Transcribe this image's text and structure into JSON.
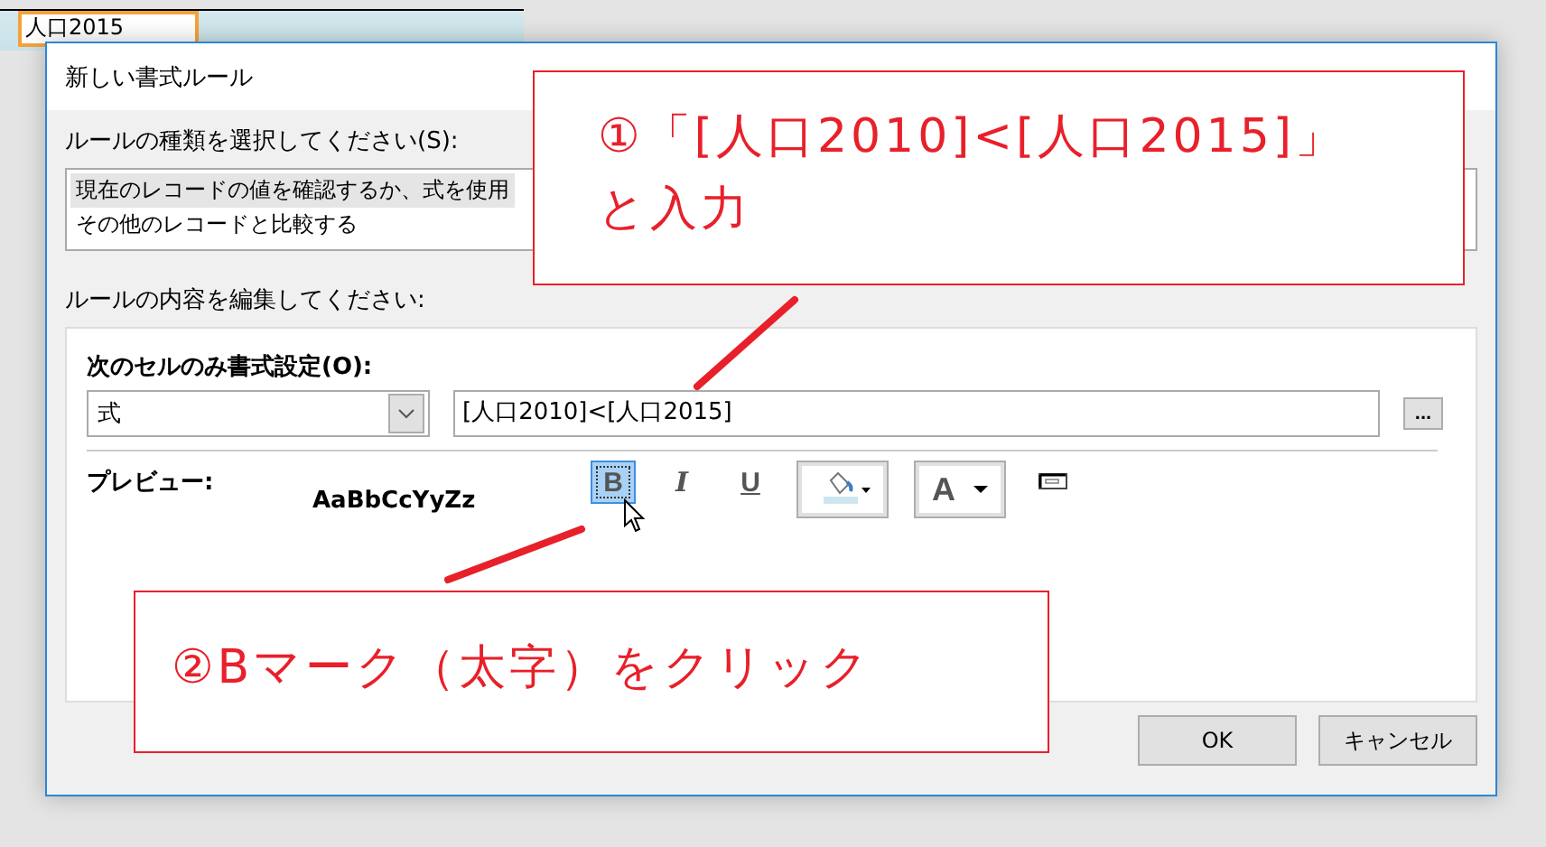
{
  "sheet": {
    "cell": "人口2015"
  },
  "dialog": {
    "title": "新しい書式ルール",
    "rule_type_label": "ルールの種類を選択してください(S):",
    "rule_types": [
      {
        "label": "現在のレコードの値を確認するか、式を使用",
        "selected": true
      },
      {
        "label": "その他のレコードと比較する",
        "selected": false
      }
    ],
    "edit_label": "ルールの内容を編集してください:",
    "condition_label": "次のセルのみ書式設定(O):",
    "condition_type": "式",
    "expression": "[人口2010]<[人口2015]",
    "browse": "...",
    "preview_label": "プレビュー:",
    "preview_sample": "AaBbCcYyZz",
    "format_buttons": [
      {
        "kind": "bold",
        "label": "B",
        "selected": true
      },
      {
        "kind": "italic",
        "label": "I",
        "selected": false
      },
      {
        "kind": "underline",
        "label": "U",
        "selected": false
      }
    ],
    "font_color_label": "A",
    "buttons": [
      "OK",
      "キャンセル"
    ]
  },
  "callouts": [
    {
      "lines": [
        "①「[人口2010]<[人口2015]」",
        "と入力"
      ]
    },
    {
      "lines": [
        "②Bマーク（太字）をクリック"
      ]
    }
  ]
}
